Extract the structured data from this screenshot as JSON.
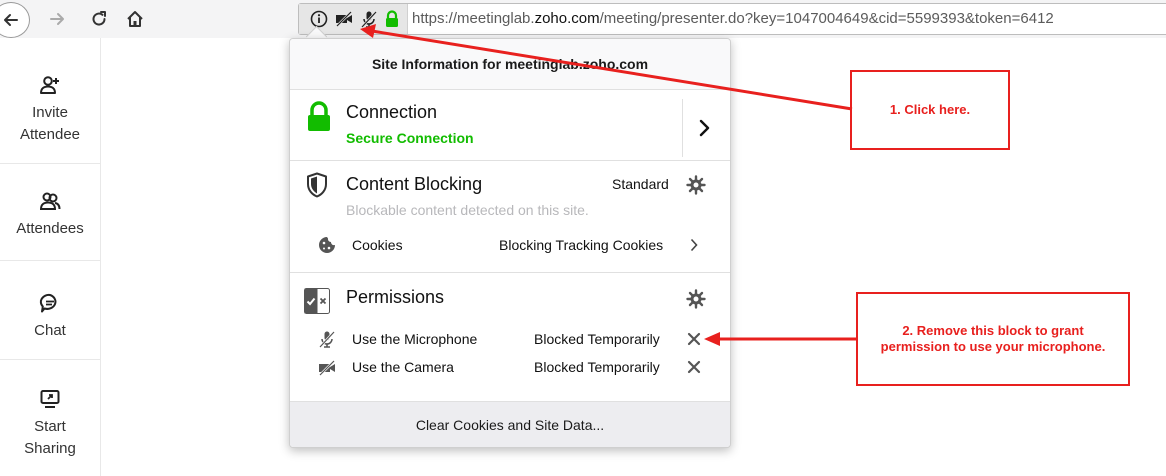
{
  "browser": {
    "url_prefix": "https://meetinglab.",
    "url_domain": "zoho.com",
    "url_suffix": "/meeting/presenter.do?key=1047004649&cid=5599393&token=6412"
  },
  "sidebar": {
    "items": [
      {
        "label_line1": "Invite",
        "label_line2": "Attendee",
        "icon": "add-person-icon"
      },
      {
        "label_line1": "Attendees",
        "label_line2": "",
        "icon": "people-icon"
      },
      {
        "label_line1": "Chat",
        "label_line2": "",
        "icon": "chat-icon"
      },
      {
        "label_line1": "Start",
        "label_line2": "Sharing",
        "icon": "screen-share-icon"
      }
    ]
  },
  "panel": {
    "header": "Site Information for meetinglab.zoho.com",
    "connection": {
      "title": "Connection",
      "status": "Secure Connection"
    },
    "content_blocking": {
      "title": "Content Blocking",
      "mode": "Standard",
      "note": "Blockable content detected on this site.",
      "cookies_label": "Cookies",
      "cookies_value": "Blocking Tracking Cookies"
    },
    "permissions": {
      "title": "Permissions",
      "items": [
        {
          "label": "Use the Microphone",
          "state": "Blocked Temporarily",
          "icon": "muted-microphone-icon"
        },
        {
          "label": "Use the Camera",
          "state": "Blocked Temporarily",
          "icon": "blocked-camera-icon"
        }
      ]
    },
    "footer_button": "Clear Cookies and Site Data..."
  },
  "annotations": {
    "callout1": "1. Click here.",
    "callout2_line1": "2. Remove this block to grant",
    "callout2_line2": "permission to use your microphone."
  },
  "colors": {
    "secure_green": "#12bc00",
    "annotation_red": "#e8201e"
  }
}
